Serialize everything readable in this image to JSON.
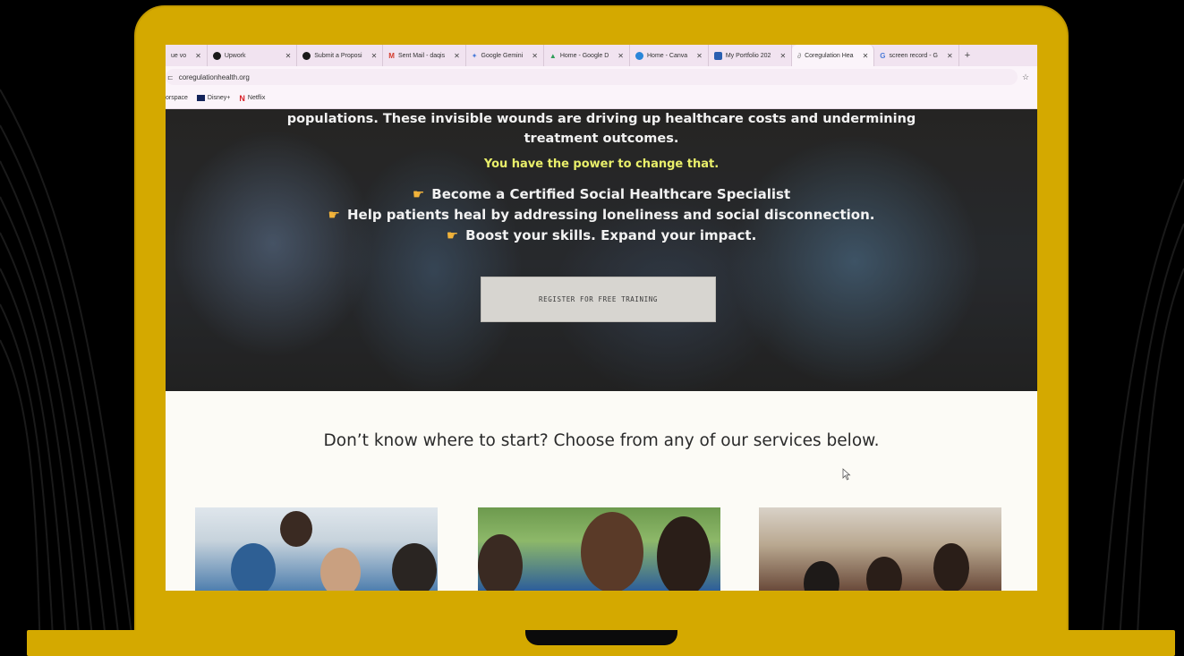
{
  "browser": {
    "tabs": [
      {
        "label": "ue vo",
        "icon_color": "#7a5ccf"
      },
      {
        "label": "Upwork",
        "icon_color": "#1a1a1a"
      },
      {
        "label": "Submit a Proposi",
        "icon_color": "#1a1a1a"
      },
      {
        "label": "Sent Mail - daqis",
        "icon_color": "#d33b2c"
      },
      {
        "label": "Google Gemini",
        "icon_color": "#4a7bd9"
      },
      {
        "label": "Home - Google D",
        "icon_color": "#2f9d58"
      },
      {
        "label": "Home - Canva",
        "icon_color": "#2a86d9"
      },
      {
        "label": "My Portfolio 202",
        "icon_color": "#2a5fb0"
      },
      {
        "label": "Coregulation Hea",
        "icon_color": "#999999",
        "active": true
      },
      {
        "label": "screen record - G",
        "icon_color": "#4a7bd9"
      }
    ],
    "new_tab_label": "+",
    "url": "coregulationhealth.org",
    "bookmarks": [
      {
        "label": "orspace",
        "icon_color": "#f1e3f0"
      },
      {
        "label": "Disney+",
        "icon_color": "#13235a"
      },
      {
        "label": "Netflix",
        "icon_color": "#d81f26"
      }
    ]
  },
  "hero": {
    "intro_line1": "populations. These invisible wounds are driving up healthcare costs and undermining",
    "intro_line2": "treatment outcomes.",
    "power_line": "You have the power to change that.",
    "bullets": [
      "Become a Certified Social Healthcare Specialist",
      "Help patients heal by addressing loneliness and social disconnection.",
      "Boost your skills. Expand your impact."
    ],
    "register_button": "REGISTER FOR FREE TRAINING"
  },
  "services": {
    "title": "Don’t know where to start? Choose from any of our services below."
  },
  "colors": {
    "laptop_frame": "#d4a900",
    "power_text": "#e9ef6a"
  }
}
